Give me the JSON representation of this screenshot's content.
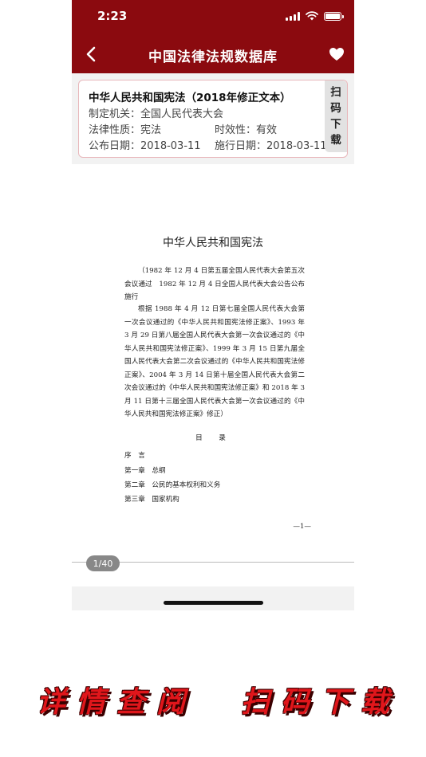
{
  "status_bar": {
    "time": "2:23"
  },
  "nav": {
    "title": "中国法律法规数据库"
  },
  "info": {
    "title": "中华人民共和国宪法（2018年修正文本）",
    "org": "制定机关：全国人民代表大会",
    "nature": "法律性质：宪法",
    "validity": "时效性：有效",
    "publish": "公布日期：2018-03-11",
    "effective": "施行日期：2018-03-11",
    "scan_chars": [
      "扫",
      "码",
      "下",
      "载"
    ]
  },
  "document": {
    "heading": "中华人民共和国宪法",
    "para1": "（1982 年 12 月 4 日第五届全国人民代表大会第五次会议通过　1982 年 12 月 4 日全国人民代表大会公告公布施行",
    "para2": "根据 1988 年 4 月 12 日第七届全国人民代表大会第一次会议通过的《中华人民共和国宪法修正案》、1993 年 3 月 29 日第八届全国人民代表大会第一次会议通过的《中华人民共和国宪法修正案》、1999 年 3 月 15 日第九届全国人民代表大会第二次会议通过的《中华人民共和国宪法修正案》、2004 年 3 月 14 日第十届全国人民代表大会第二次会议通过的《中华人民共和国宪法修正案》和 2018 年 3 月 11 日第十三届全国人民代表大会第一次会议通过的《中华人民共和国宪法修正案》修正）",
    "toc_title": "目　录",
    "toc": [
      "序　言",
      "第一章　总纲",
      "第二章　公民的基本权利和义务",
      "第三章　国家机构"
    ],
    "page_number": "—1—"
  },
  "pager": {
    "label": "1/40"
  },
  "promo": {
    "left": "详情查阅",
    "right": "扫码下载"
  },
  "colors": {
    "brand": "#8b0a0f",
    "card_border": "#e8b7bb",
    "promo": "#e0161b"
  }
}
